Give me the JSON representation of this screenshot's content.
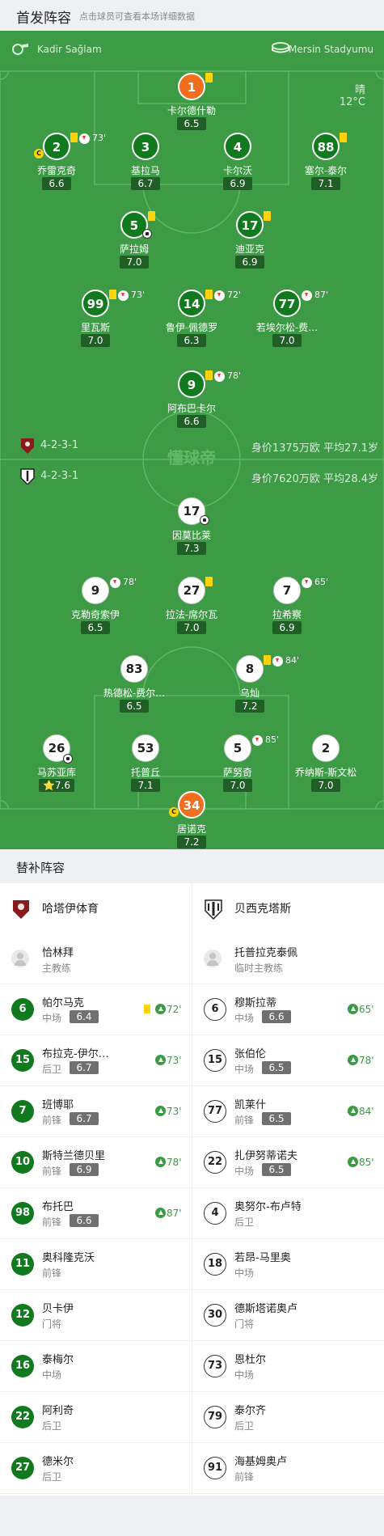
{
  "header": {
    "title": "首发阵容",
    "subtitle": "点击球员可查看本场详细数据"
  },
  "match": {
    "referee": "Kadir Sağlam",
    "stadium": "Mersin Stadyumu",
    "weather": "晴",
    "temperature": "12°C",
    "watermark": "懂球帝",
    "home_formation": "4-2-3-1",
    "away_formation": "4-2-3-1",
    "home_value": "身价1375万欧 平均27.1岁",
    "away_value": "身价7620万欧 平均28.4岁"
  },
  "home_players": [
    {
      "num": "1",
      "name": "卡尔德什勒",
      "rating": "6.5",
      "yellow": true
    },
    {
      "num": "2",
      "name": "乔雷克奇",
      "rating": "6.6",
      "yellow": true,
      "sub": "73'",
      "captain": true
    },
    {
      "num": "3",
      "name": "基拉马",
      "rating": "6.7"
    },
    {
      "num": "4",
      "name": "卡尔沃",
      "rating": "6.9"
    },
    {
      "num": "88",
      "name": "塞尔-泰尔",
      "rating": "7.1",
      "yellow": true
    },
    {
      "num": "5",
      "name": "萨拉姆",
      "rating": "7.0",
      "yellow": true,
      "goal": true
    },
    {
      "num": "17",
      "name": "迪亚克",
      "rating": "6.9",
      "yellow": true
    },
    {
      "num": "99",
      "name": "里瓦斯",
      "rating": "7.0",
      "yellow": true,
      "sub": "73'"
    },
    {
      "num": "14",
      "name": "鲁伊-佩德罗",
      "rating": "6.3",
      "yellow": true,
      "sub": "72'"
    },
    {
      "num": "77",
      "name": "若埃尔松-费…",
      "rating": "7.0",
      "sub": "87'"
    },
    {
      "num": "9",
      "name": "阿布巴卡尔",
      "rating": "6.6",
      "yellow": true,
      "sub": "78'"
    }
  ],
  "away_players": [
    {
      "num": "17",
      "name": "因莫比莱",
      "rating": "7.3",
      "goal": true
    },
    {
      "num": "9",
      "name": "克勒奇索伊",
      "rating": "6.5",
      "sub": "78'"
    },
    {
      "num": "27",
      "name": "拉法-席尔瓦",
      "rating": "7.0",
      "yellow": true
    },
    {
      "num": "7",
      "name": "拉希察",
      "rating": "6.9",
      "sub": "65'"
    },
    {
      "num": "83",
      "name": "热德松-费尔…",
      "rating": "6.5"
    },
    {
      "num": "8",
      "name": "乌灿",
      "rating": "7.2",
      "yellow": true,
      "sub": "84'"
    },
    {
      "num": "26",
      "name": "马苏亚库",
      "rating": "7.6",
      "assist": true,
      "mvp": "⭐"
    },
    {
      "num": "53",
      "name": "托普丘",
      "rating": "7.1"
    },
    {
      "num": "5",
      "name": "萨努奇",
      "rating": "7.0",
      "sub": "85'"
    },
    {
      "num": "2",
      "name": "乔纳斯-斯文松",
      "rating": "7.0"
    },
    {
      "num": "34",
      "name": "居诺克",
      "rating": "7.2",
      "captain": true
    }
  ],
  "bench": {
    "title": "替补阵容",
    "home": {
      "team": "哈塔伊体育",
      "coach": {
        "name": "恰林拜",
        "role": "主教练"
      },
      "players": [
        {
          "num": "6",
          "name": "帕尔马克",
          "pos": "中场",
          "rating": "6.4",
          "yellow": true,
          "in": "72'"
        },
        {
          "num": "15",
          "name": "布拉克-伊尔…",
          "pos": "后卫",
          "rating": "6.7",
          "in": "73'"
        },
        {
          "num": "7",
          "name": "班博耶",
          "pos": "前锋",
          "rating": "6.7",
          "in": "73'"
        },
        {
          "num": "10",
          "name": "斯特兰德贝里",
          "pos": "前锋",
          "rating": "6.9",
          "in": "78'"
        },
        {
          "num": "98",
          "name": "布托巴",
          "pos": "前锋",
          "rating": "6.6",
          "in": "87'"
        },
        {
          "num": "11",
          "name": "奥科隆克沃",
          "pos": "前锋"
        },
        {
          "num": "12",
          "name": "贝卡伊",
          "pos": "门将"
        },
        {
          "num": "16",
          "name": "泰梅尔",
          "pos": "中场"
        },
        {
          "num": "22",
          "name": "阿利奇",
          "pos": "后卫"
        },
        {
          "num": "27",
          "name": "德米尔",
          "pos": "后卫"
        }
      ]
    },
    "away": {
      "team": "贝西克塔斯",
      "coach": {
        "name": "托普拉克泰佩",
        "role": "临时主教练"
      },
      "players": [
        {
          "num": "6",
          "name": "穆斯拉蒂",
          "pos": "中场",
          "rating": "6.6",
          "in": "65'"
        },
        {
          "num": "15",
          "name": "张伯伦",
          "pos": "中场",
          "rating": "6.5",
          "in": "78'"
        },
        {
          "num": "77",
          "name": "凯莱什",
          "pos": "前锋",
          "rating": "6.5",
          "in": "84'"
        },
        {
          "num": "22",
          "name": "扎伊努蒂诺夫",
          "pos": "中场",
          "rating": "6.5",
          "in": "85'"
        },
        {
          "num": "4",
          "name": "奥努尔-布卢特",
          "pos": "后卫"
        },
        {
          "num": "18",
          "name": "若昂-马里奥",
          "pos": "中场"
        },
        {
          "num": "30",
          "name": "德斯塔诺奥卢",
          "pos": "门将"
        },
        {
          "num": "73",
          "name": "恩杜尔",
          "pos": "中场"
        },
        {
          "num": "79",
          "name": "泰尔齐",
          "pos": "后卫"
        },
        {
          "num": "91",
          "name": "海基姆奥卢",
          "pos": "前锋"
        }
      ]
    }
  }
}
